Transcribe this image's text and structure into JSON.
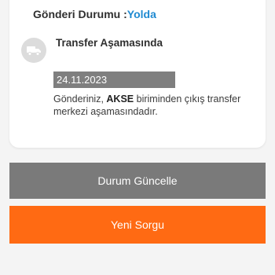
{
  "header": {
    "label": "Gönderi Durumu :",
    "value": "Yolda",
    "value_color": "#1f8ad1"
  },
  "stage": {
    "icon": "truck-icon",
    "title": "Transfer Aşamasında",
    "date": "24.11.2023",
    "description_prefix": "Gönderiniz, ",
    "description_branch": "AKSE",
    "description_suffix": " biriminden çıkış transfer merkezi aşamasındadır."
  },
  "buttons": {
    "update_label": "Durum Güncelle",
    "update_color": "#7a7a7a",
    "new_query_label": "Yeni Sorgu",
    "new_query_color": "#ff6a13"
  }
}
